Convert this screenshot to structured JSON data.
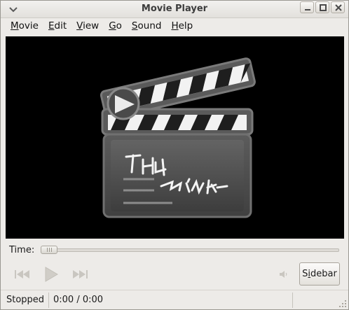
{
  "window": {
    "title": "Movie Player"
  },
  "menubar": {
    "items": [
      {
        "label": "Movie",
        "mnemonic": "M",
        "rest": "ovie"
      },
      {
        "label": "Edit",
        "mnemonic": "E",
        "rest": "dit"
      },
      {
        "label": "View",
        "mnemonic": "V",
        "rest": "iew"
      },
      {
        "label": "Go",
        "mnemonic": "G",
        "rest": "o"
      },
      {
        "label": "Sound",
        "mnemonic": "S",
        "rest": "ound"
      },
      {
        "label": "Help",
        "mnemonic": "H",
        "rest": "elp"
      }
    ]
  },
  "video": {
    "logo": "clapperboard-icon"
  },
  "seek": {
    "label": "Time:",
    "position": 0
  },
  "controls": {
    "previous_icon": "skip-back-icon",
    "play_icon": "play-icon",
    "next_icon": "skip-forward-icon",
    "volume_icon": "speaker-icon",
    "sidebar_pre": "S",
    "sidebar_mnemonic": "i",
    "sidebar_post": "debar"
  },
  "status": {
    "state": "Stopped",
    "time": "0:00 / 0:00"
  },
  "colors": {
    "video_bg": "#000000",
    "window_bg": "#edebe8"
  }
}
